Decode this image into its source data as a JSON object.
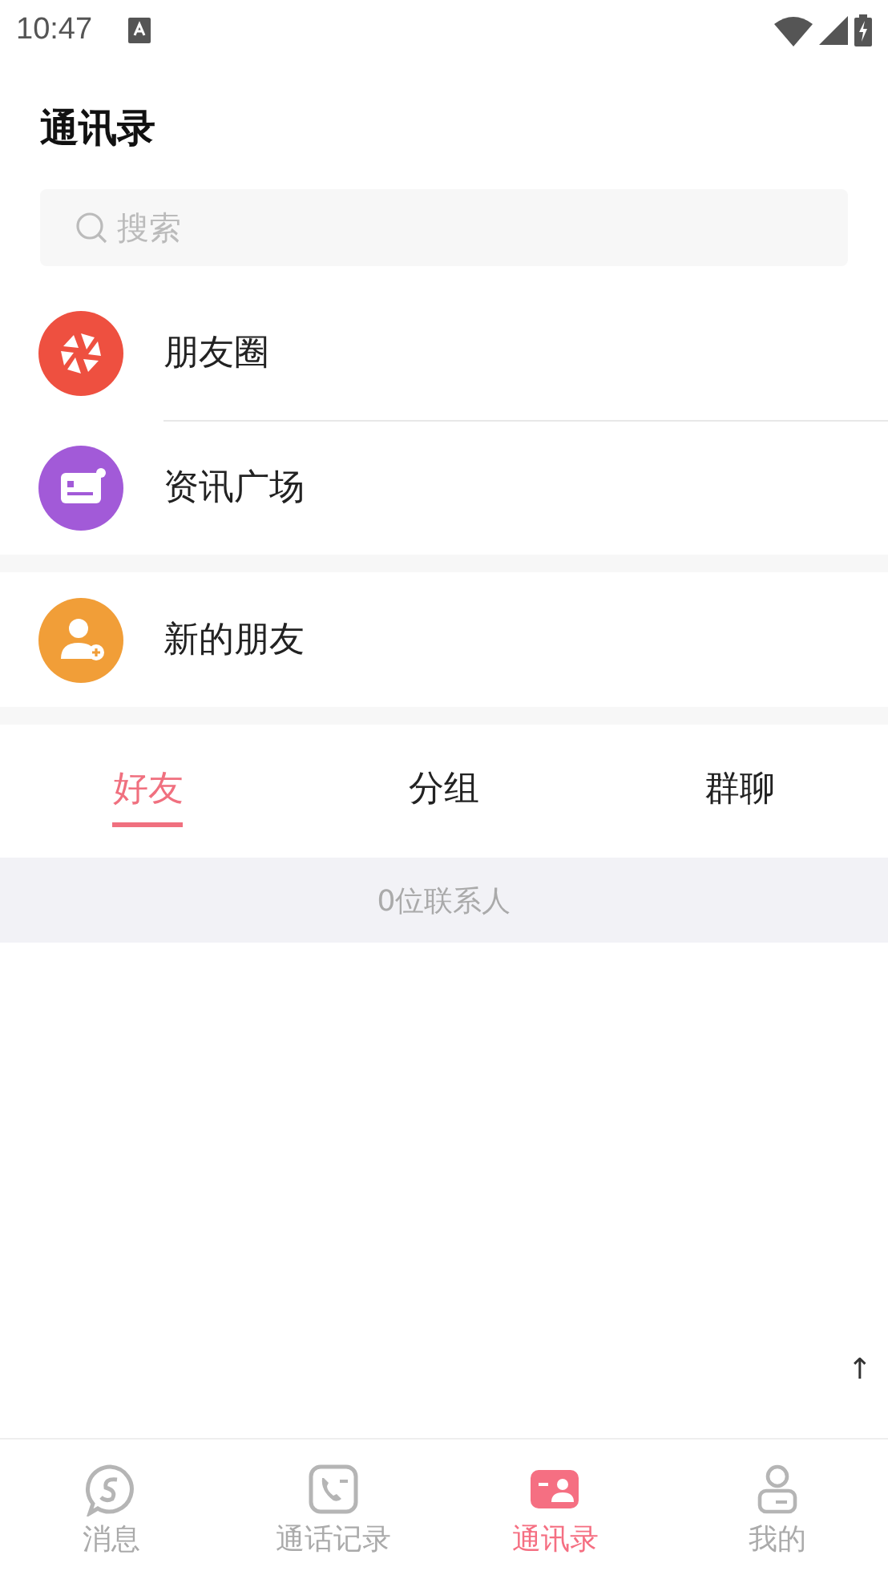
{
  "status_bar": {
    "time": "10:47"
  },
  "title": "通讯录",
  "search": {
    "placeholder": "搜索"
  },
  "sections": [
    {
      "entries": [
        {
          "kind": "moments",
          "label": "朋友圈",
          "color": "#ee5040"
        },
        {
          "kind": "news",
          "label": "资讯广场",
          "color": "#a25ad8"
        }
      ]
    },
    {
      "entries": [
        {
          "kind": "new-friend",
          "label": "新的朋友",
          "color": "#f19e38"
        }
      ]
    }
  ],
  "tabs": [
    {
      "label": "好友",
      "selected": true
    },
    {
      "label": "分组",
      "selected": false
    },
    {
      "label": "群聊",
      "selected": false
    }
  ],
  "count": "0位联系人",
  "scroll_top": "↑",
  "nav": [
    {
      "kind": "chat",
      "label": "消息",
      "selected": false
    },
    {
      "kind": "calls",
      "label": "通话记录",
      "selected": false
    },
    {
      "kind": "contacts",
      "label": "通讯录",
      "selected": true
    },
    {
      "kind": "me",
      "label": "我的",
      "selected": false
    }
  ]
}
